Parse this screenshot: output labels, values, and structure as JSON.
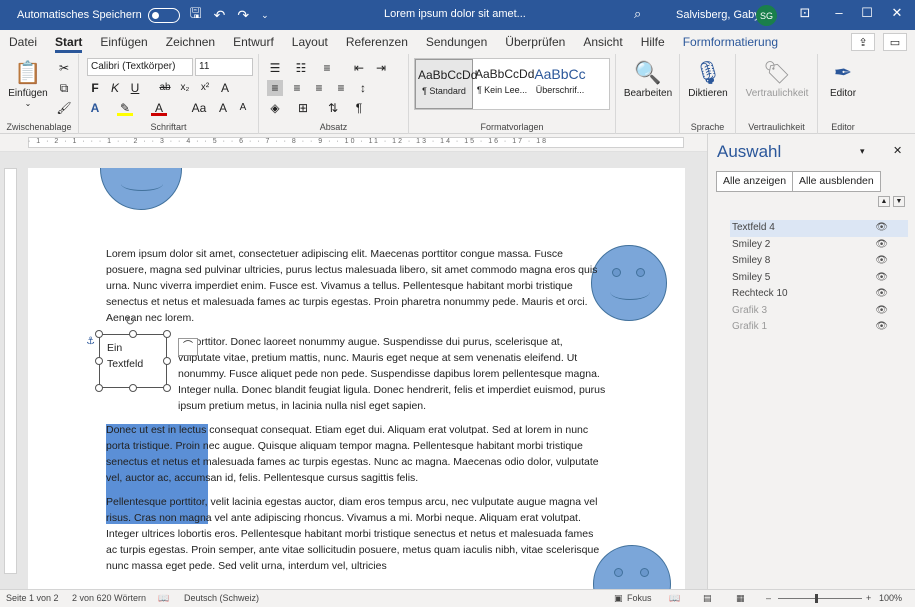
{
  "titlebar": {
    "autosave_label": "Automatisches Speichern",
    "autosave_state": "Aus",
    "doc_title": "Lorem ipsum dolor sit amet...",
    "user_name": "Salvisberg, Gaby",
    "user_initials": "SG"
  },
  "tabs": [
    "Datei",
    "Start",
    "Einfügen",
    "Zeichnen",
    "Entwurf",
    "Layout",
    "Referenzen",
    "Sendungen",
    "Überprüfen",
    "Ansicht",
    "Hilfe",
    "Formformatierung"
  ],
  "ribbon": {
    "clipboard": {
      "paste": "Einfügen",
      "label": "Zwischenablage"
    },
    "font": {
      "name": "Calibri (Textkörper)",
      "size": "11",
      "label": "Schriftart"
    },
    "paragraph": {
      "label": "Absatz"
    },
    "styles": {
      "items": [
        {
          "preview": "AaBbCcDd",
          "name": "¶ Standard"
        },
        {
          "preview": "AaBbCcDd",
          "name": "¶ Kein Lee..."
        },
        {
          "preview": "AaBbCc",
          "name": "Überschrif..."
        }
      ],
      "label": "Formatvorlagen"
    },
    "editing": {
      "button": "Bearbeiten"
    },
    "voice": {
      "button": "Diktieren",
      "label": "Sprache"
    },
    "sensitivity": {
      "button": "Vertraulichkeit",
      "label": "Vertraulichkeit"
    },
    "editor": {
      "button": "Editor",
      "label": "Editor"
    }
  },
  "document": {
    "paragraphs": [
      "Lorem ipsum dolor sit amet, consectetuer adipiscing elit. Maecenas porttitor congue massa. Fusce posuere, magna sed pulvinar ultricies, purus lectus malesuada libero, sit amet commodo magna eros quis urna. Nunc viverra imperdiet enim. Fusce est. Vivamus a tellus. Pellentesque habitant morbi tristique senectus et netus et malesuada fames ac turpis egestas. Proin pharetra nonummy pede. Mauris et orci. Aenean nec lorem.",
      "In porttitor. Donec laoreet nonummy augue. Suspendisse dui purus, scelerisque at, vulputate vitae, pretium mattis, nunc. Mauris eget neque at sem venenatis eleifend. Ut nonummy. Fusce aliquet pede non pede. Suspendisse dapibus lorem pellentesque magna. Integer nulla. Donec blandit feugiat ligula. Donec hendrerit, felis et imperdiet euismod, purus ipsum pretium metus, in lacinia nulla nisl eget sapien.",
      "Donec ut est in lectus consequat consequat. Etiam eget dui. Aliquam erat volutpat. Sed at lorem in nunc porta tristique. Proin nec augue. Quisque aliquam tempor magna. Pellentesque habitant morbi tristique senectus et netus et malesuada fames ac turpis egestas. Nunc ac magna. Maecenas odio dolor, vulputate vel, auctor ac, accumsan id, felis. Pellentesque cursus sagittis felis.",
      "Pellentesque porttitor, velit lacinia egestas auctor, diam eros tempus arcu, nec vulputate augue magna vel risus. Cras non magna vel ante adipiscing rhoncus. Vivamus a mi. Morbi neque. Aliquam erat volutpat. Integer ultrices lobortis eros. Pellentesque habitant morbi tristique senectus et netus et malesuada fames ac turpis egestas. Proin semper, ante vitae sollicitudin posuere, metus quam iaculis nibh, vitae scelerisque nunc massa eget pede. Sed velit urna, interdum vel, ultricies"
    ],
    "textbox_text": "Ein Textfeld"
  },
  "selection_pane": {
    "title": "Auswahl",
    "show_all": "Alle anzeigen",
    "hide_all": "Alle ausblenden",
    "items": [
      {
        "name": "Textfeld 4",
        "state": "active"
      },
      {
        "name": "Smiley 2",
        "state": "visible"
      },
      {
        "name": "Smiley 8",
        "state": "visible"
      },
      {
        "name": "Smiley 5",
        "state": "visible"
      },
      {
        "name": "Rechteck 10",
        "state": "visible"
      },
      {
        "name": "Grafik 3",
        "state": "dim"
      },
      {
        "name": "Grafik 1",
        "state": "dim"
      }
    ]
  },
  "statusbar": {
    "page": "Seite 1 von 2",
    "words": "2 von 620 Wörtern",
    "language": "Deutsch (Schweiz)",
    "focus": "Fokus",
    "zoom": "100%"
  }
}
